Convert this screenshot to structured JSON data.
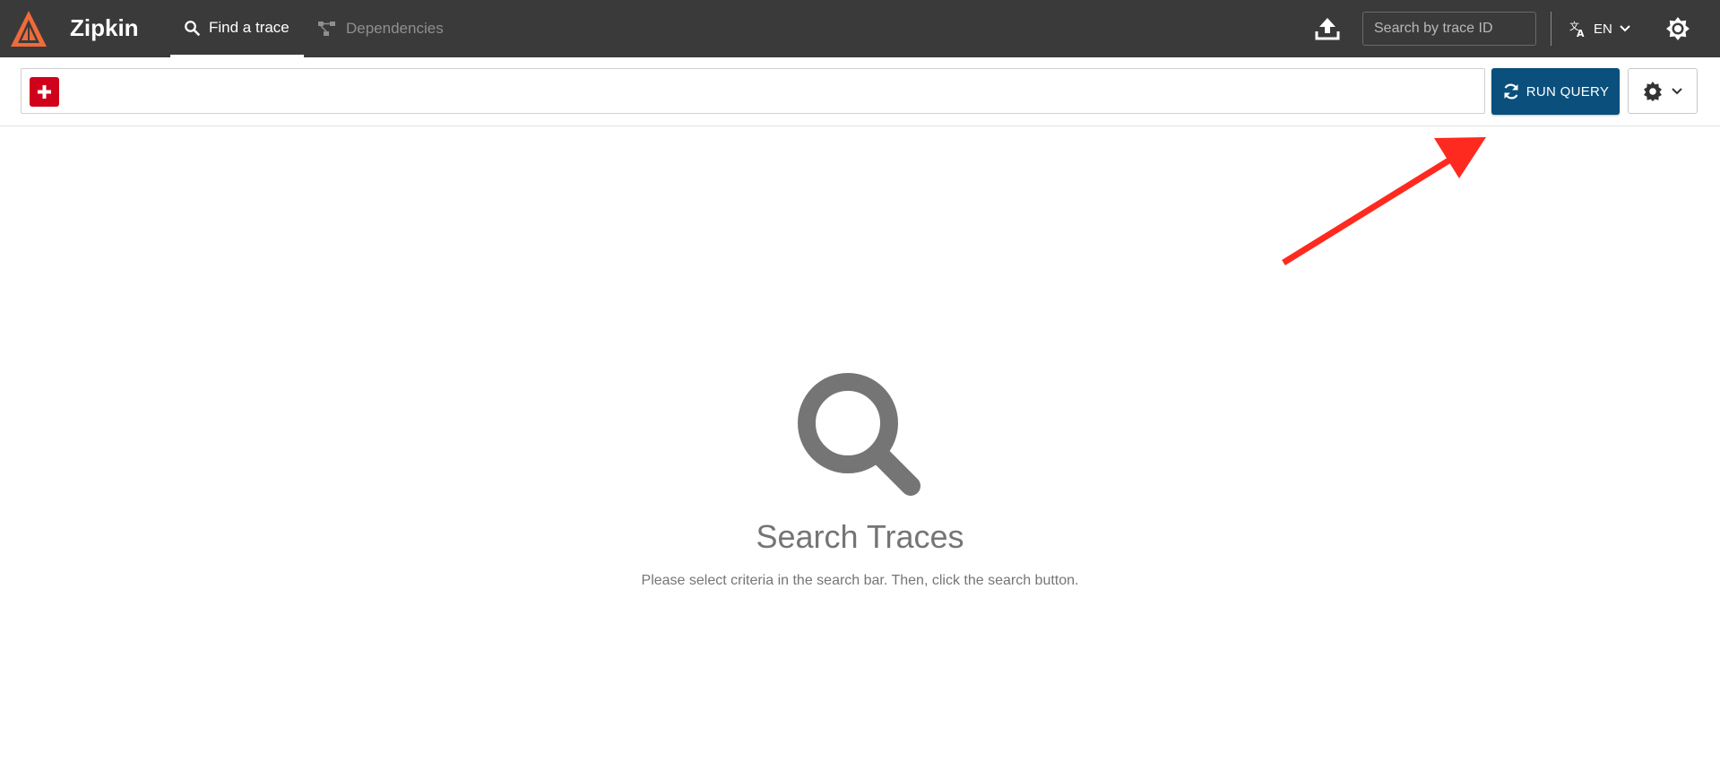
{
  "app": {
    "name": "Zipkin",
    "logo_icon": "zipkin-logo-icon",
    "brand_color": "#f06a3a"
  },
  "header": {
    "background_color": "#3a3a3a",
    "tabs": [
      {
        "label": "Find a trace",
        "icon": "search-icon",
        "active": true
      },
      {
        "label": "Dependencies",
        "icon": "dependencies-graph-icon",
        "active": false
      }
    ],
    "upload_icon": "upload-icon",
    "trace_search": {
      "placeholder": "Search by trace ID",
      "value": ""
    },
    "language": {
      "icon": "translate-icon",
      "label": "EN",
      "chevron": "chevron-down-icon"
    },
    "theme_icon": "theme-toggle-icon"
  },
  "toolbar": {
    "add_icon": "plus-icon",
    "add_color": "#d0021b",
    "run_query_label": "RUN QUERY",
    "run_query_icon": "refresh-icon",
    "run_query_color": "#0b4f7c",
    "settings_icon": "gear-icon",
    "settings_chevron": "chevron-down-icon"
  },
  "annotation": {
    "type": "arrow",
    "color": "#ff2a1f",
    "points_to": "run-query-button"
  },
  "empty_state": {
    "icon": "search-icon",
    "title": "Search Traces",
    "message": "Please select criteria in the search bar. Then, click the search button."
  }
}
